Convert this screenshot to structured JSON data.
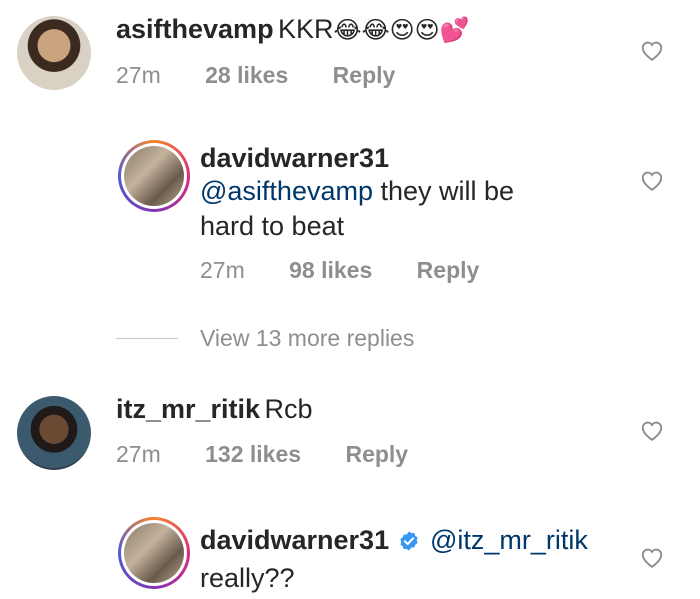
{
  "comments": [
    {
      "username": "asifthevamp",
      "text": "KKR",
      "emojis": "😂😂😍😍💕",
      "time": "27m",
      "likes": "28 likes",
      "reply": "Reply"
    },
    {
      "username": "davidwarner31",
      "mention": "@asifthevamp",
      "text_line1": " they will be",
      "text_line2": "hard to beat",
      "time": "27m",
      "likes": "98 likes",
      "reply": "Reply"
    },
    {
      "username": "itz_mr_ritik",
      "text": "Rcb",
      "time": "27m",
      "likes": "132 likes",
      "reply": "Reply"
    },
    {
      "username": "davidwarner31",
      "mention": "@itz_mr_ritik",
      "text_line2": "really??",
      "verified": true
    }
  ],
  "view_more": "View 13 more replies",
  "colors": {
    "mention": "#00376b",
    "meta": "#8e8e8e",
    "verified": "#3897f0"
  },
  "icons": [
    "heart-outline-icon",
    "verified-badge-icon"
  ]
}
